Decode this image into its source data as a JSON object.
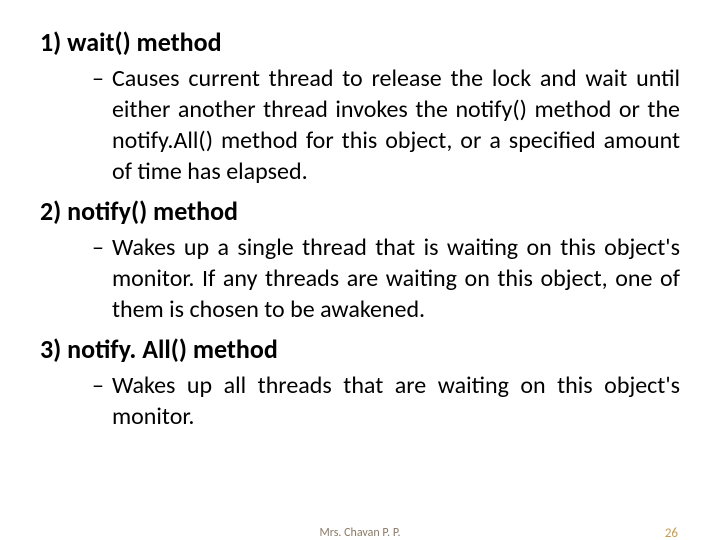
{
  "sections": [
    {
      "heading": "1) wait() method",
      "bullet": "Causes current thread to release the lock and wait until either another thread invokes the notify() method or the notify.All() method for this object, or a specified amount of time has elapsed."
    },
    {
      "heading": "2) notify() method",
      "bullet": "Wakes up a single thread that is waiting on this object's monitor. If any threads are waiting on this object, one of them is chosen to be awakened."
    },
    {
      "heading": "3) notify. All() method",
      "bullet": "Wakes up all threads that are waiting on this object's monitor."
    }
  ],
  "footer": {
    "author": "Mrs. Chavan P. P.",
    "page": "26"
  },
  "dash": "–"
}
